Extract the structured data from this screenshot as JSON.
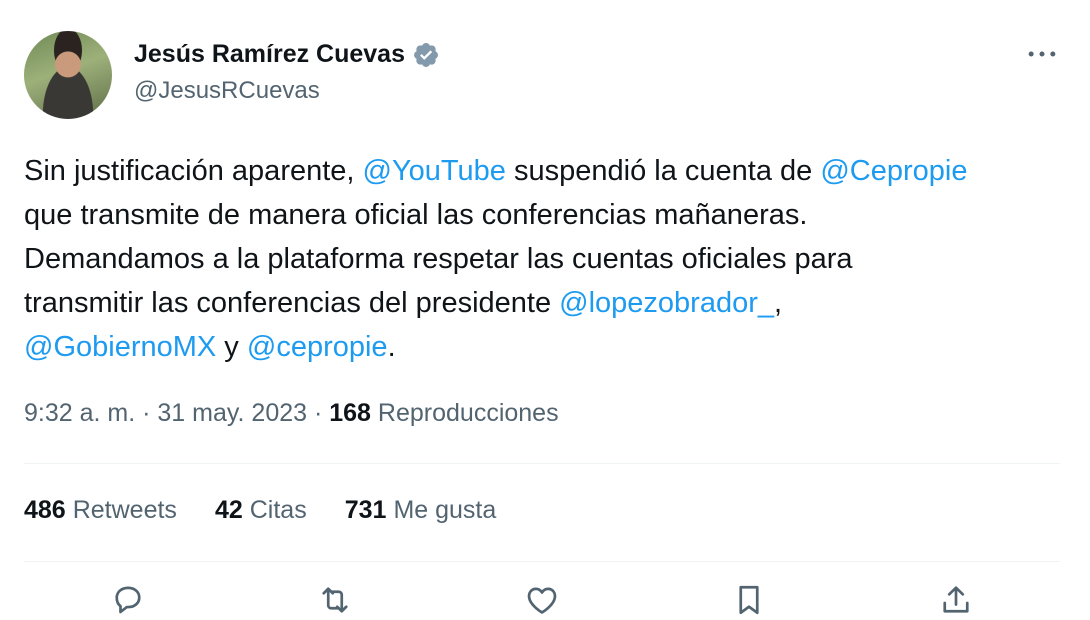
{
  "author": {
    "name": "Jesús Ramírez Cuevas",
    "handle": "@JesusRCuevas"
  },
  "tweet": {
    "line1": {
      "t1": "Sin justificación aparente, ",
      "m1": "@YouTube",
      "t2": " suspendió la cuenta de ",
      "m2": "@Cepropie"
    },
    "line2": "que transmite de manera oficial las conferencias mañaneras.",
    "line3": "Demandamos a la plataforma respetar las cuentas oficiales para",
    "line4": {
      "t1": "transmitir las conferencias del presidente ",
      "m1": "@lopezobrador_",
      "t2": ","
    },
    "line5": {
      "m1": "@GobiernoMX",
      "t1": " y ",
      "m2": "@cepropie",
      "t2": "."
    }
  },
  "meta": {
    "time": "9:32 a. m.",
    "sep1": " · ",
    "date": "31 may. 2023",
    "sep2": " · ",
    "views_count": "168",
    "views_label": " Reproducciones"
  },
  "stats": {
    "retweets_count": "486",
    "retweets_label": "Retweets",
    "quotes_count": "42",
    "quotes_label": "Citas",
    "likes_count": "731",
    "likes_label": "Me gusta"
  },
  "icons": {
    "verified": "verified-badge-icon",
    "more": "more-options-icon",
    "reply": "reply-icon",
    "retweet": "retweet-icon",
    "like": "like-icon",
    "bookmark": "bookmark-icon",
    "share": "share-icon"
  },
  "colors": {
    "mention": "#1d9bf0",
    "secondary_text": "#536471",
    "primary_text": "#0f1419",
    "verified_badge": "#829aab"
  }
}
